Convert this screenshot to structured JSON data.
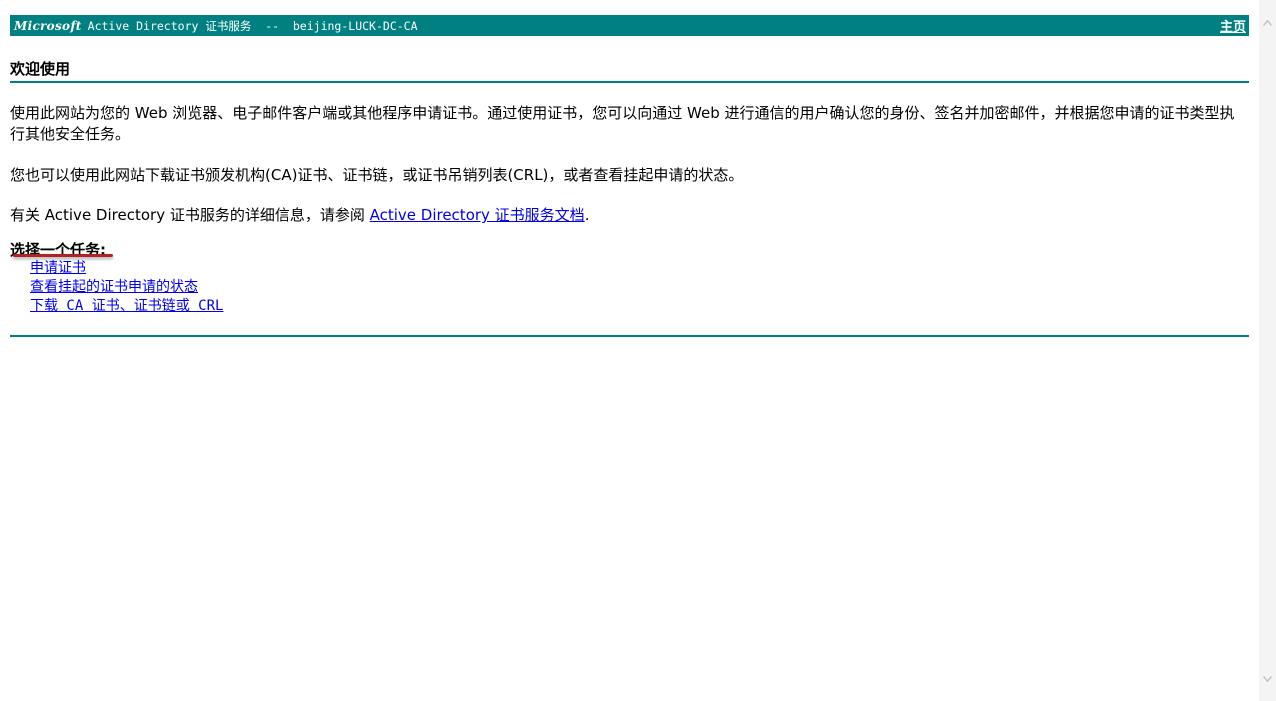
{
  "header": {
    "brand": "Microsoft",
    "title": "Active Directory 证书服务  --  beijing-LUCK-DC-CA",
    "home_link": "主页"
  },
  "welcome": {
    "title": "欢迎使用",
    "paragraph1": "使用此网站为您的 Web 浏览器、电子邮件客户端或其他程序申请证书。通过使用证书，您可以向通过 Web 进行通信的用户确认您的身份、签名并加密邮件，并根据您申请的证书类型执行其他安全任务。",
    "paragraph2": "您也可以使用此网站下载证书颁发机构(CA)证书、证书链，或证书吊销列表(CRL)，或者查看挂起申请的状态。",
    "paragraph3_prefix": "有关 Active Directory 证书服务的详细信息，请参阅 ",
    "paragraph3_link": "Active Directory 证书服务文档",
    "paragraph3_suffix": "."
  },
  "tasks": {
    "heading": "选择一个任务:",
    "items": [
      {
        "label": "申请证书"
      },
      {
        "label": "查看挂起的证书申请的状态"
      },
      {
        "label": "下载 CA 证书、证书链或 CRL"
      }
    ]
  },
  "scrollbar": {
    "up_icon": "triangle-up",
    "down_icon": "triangle-down"
  },
  "colors": {
    "accent": "#008080",
    "link": "#0000ee",
    "highlight": "#b22222"
  }
}
